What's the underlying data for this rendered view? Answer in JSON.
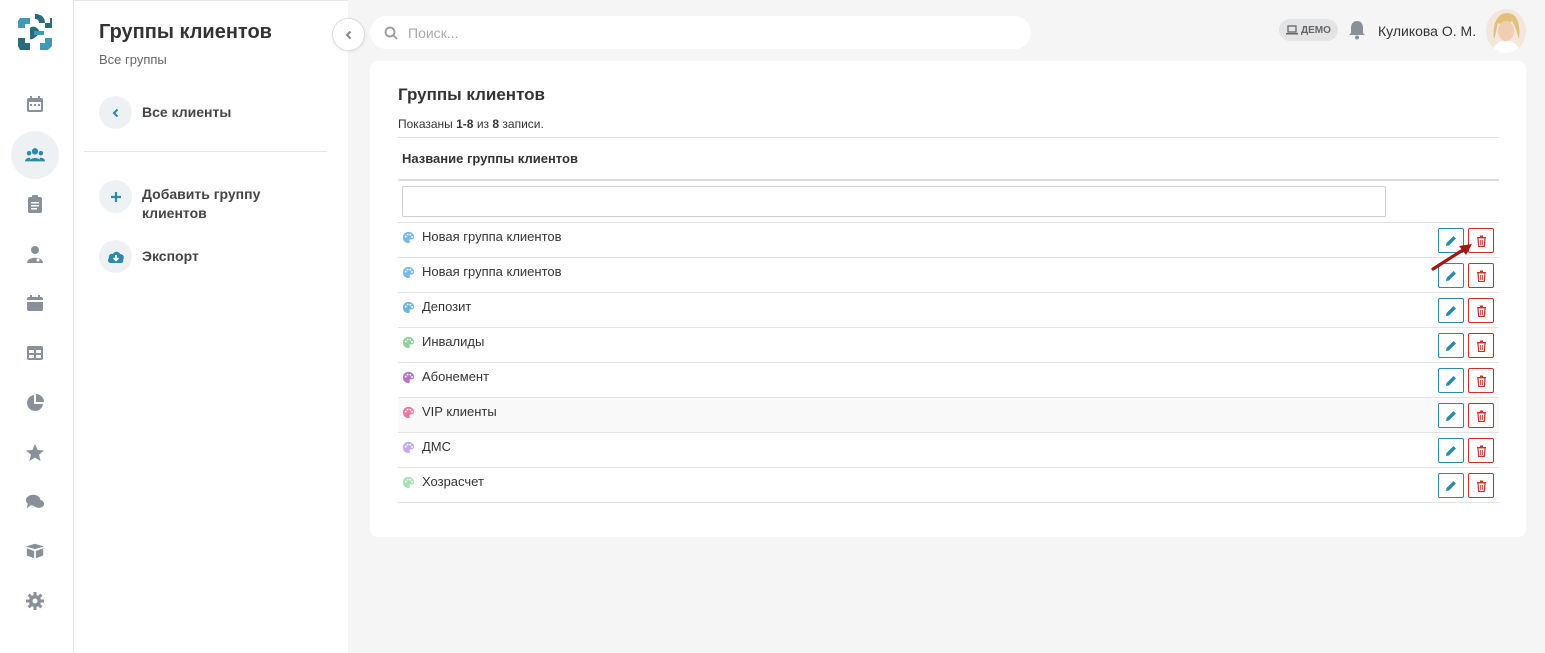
{
  "app": {
    "panel_title": "Группы клиентов",
    "panel_subtitle": "Все группы",
    "back_link": "Все клиенты",
    "add_group": "Добавить группу клиентов",
    "export": "Экспорт"
  },
  "nav_icons": [
    "calendar-icon",
    "clients-icon",
    "clipboard-icon",
    "doctor-icon",
    "schedule-icon",
    "table-icon",
    "pie-chart-icon",
    "star-icon",
    "chat-icon",
    "box-icon",
    "gear-icon"
  ],
  "header": {
    "search_placeholder": "Поиск...",
    "demo_badge": "ДЕМО",
    "user_name": "Куликова О. М."
  },
  "card": {
    "title": "Группы клиентов",
    "summary_prefix": "Показаны",
    "summary_range": "1-8",
    "summary_mid": "из",
    "summary_total": "8",
    "summary_suffix": "записи.",
    "column_header": "Название группы клиентов",
    "filter_value": ""
  },
  "groups": [
    {
      "name": "Новая группа клиентов",
      "color": "#7ab8e6"
    },
    {
      "name": "Новая группа клиентов",
      "color": "#7ab8e6"
    },
    {
      "name": "Депозит",
      "color": "#6fb3df"
    },
    {
      "name": "Инвалиды",
      "color": "#8fd19a"
    },
    {
      "name": "Абонемент",
      "color": "#b574c4"
    },
    {
      "name": "VIP клиенты",
      "color": "#e67aa0"
    },
    {
      "name": "ДМС",
      "color": "#c2a9e8"
    },
    {
      "name": "Хозрасчет",
      "color": "#a8e0b4"
    }
  ],
  "colors": {
    "edit": "#2b8aa8",
    "delete": "#c9302c",
    "accent": "#2b8aa8",
    "arrow": "#a31515"
  }
}
